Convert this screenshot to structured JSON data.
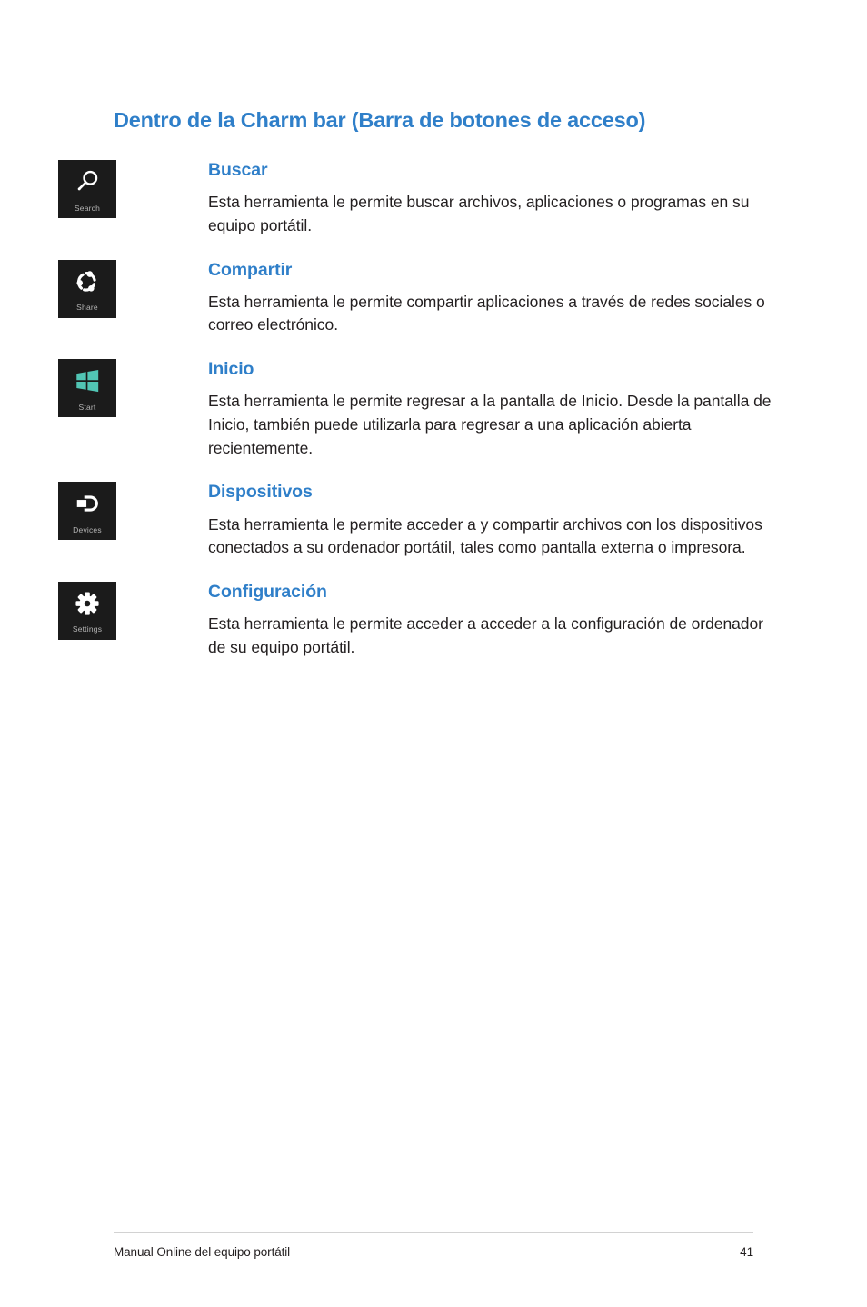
{
  "page": {
    "section_title": "Dentro de la Charm bar (Barra de botones de acceso)",
    "title_color": "#2f7fc9",
    "body_color": "#231f20",
    "background": "#ffffff"
  },
  "charms": [
    {
      "tile_label": "Search",
      "tile_icon": "magnifier-icon",
      "tile_background": "#1b1b1b",
      "tile_icon_color": "#ffffff",
      "name": "Buscar",
      "description": "Esta herramienta le permite buscar archivos, aplicaciones o programas en su equipo portátil."
    },
    {
      "tile_label": "Share",
      "tile_icon": "share-nodes-icon",
      "tile_background": "#1b1b1b",
      "tile_icon_color": "#ffffff",
      "name": "Compartir",
      "description": "Esta herramienta le permite compartir aplicaciones a través de redes sociales o correo electrónico."
    },
    {
      "tile_label": "Start",
      "tile_icon": "windows-logo-icon",
      "tile_background": "#1b1b1b",
      "tile_icon_color": "#51c5b4",
      "name": "Inicio",
      "description": "Esta herramienta le permite regresar a la pantalla de Inicio. Desde la pantalla de Inicio, también puede utilizarla para regresar a una aplicación abierta recientemente."
    },
    {
      "tile_label": "Devices",
      "tile_icon": "devices-icon",
      "tile_background": "#1b1b1b",
      "tile_icon_color": "#ffffff",
      "name": "Dispositivos",
      "description": "Esta herramienta le permite acceder a y compartir archivos con los dispositivos conectados a su ordenador portátil, tales como pantalla externa o impresora."
    },
    {
      "tile_label": "Settings",
      "tile_icon": "gear-icon",
      "tile_background": "#1b1b1b",
      "tile_icon_color": "#ffffff",
      "name": "Configuración",
      "description": "Esta herramienta le permite acceder a acceder a la configuración de ordenador de su equipo portátil."
    }
  ],
  "footer": {
    "text": "Manual Online del equipo portátil",
    "page_number": "41"
  }
}
